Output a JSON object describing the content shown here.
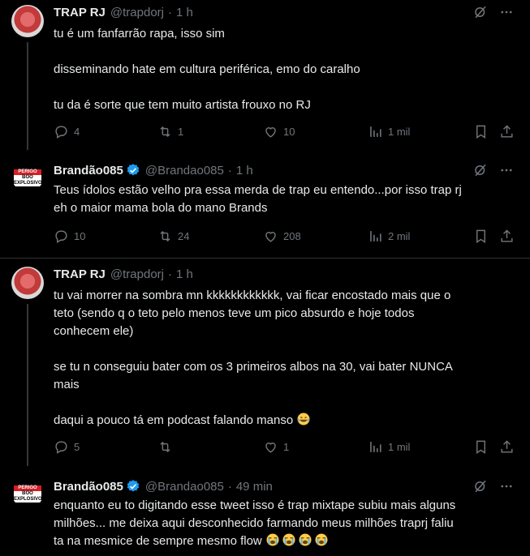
{
  "tweets": [
    {
      "name": "TRAP RJ",
      "handle": "@trapdorj",
      "time": "1 h",
      "verified": false,
      "paragraphs": [
        [
          "tu é um fanfarrão rapa, isso sim"
        ],
        [
          "disseminando hate em cultura periférica, emo do caralho"
        ],
        [
          "tu da é sorte que tem muito artista frouxo no RJ"
        ]
      ],
      "stats": {
        "replies": "4",
        "retweets": "1",
        "likes": "10",
        "views": "1 mil"
      }
    },
    {
      "name": "Brandão085",
      "handle": "@Brandao085",
      "time": "1 h",
      "verified": true,
      "paragraphs": [
        [
          "Teus ídolos estão velho pra essa merda de trap eu entendo...por isso trap rj",
          "eh o maior mama bola do mano Brands"
        ]
      ],
      "stats": {
        "replies": "10",
        "retweets": "24",
        "likes": "208",
        "views": "2 mil"
      }
    },
    {
      "name": "TRAP RJ",
      "handle": "@trapdorj",
      "time": "1 h",
      "verified": false,
      "paragraphs": [
        [
          "tu vai morrer na sombra mn kkkkkkkkkkkk, vai ficar encostado mais que o",
          "teto (sendo q o teto pelo menos teve um pico absurdo e hoje todos",
          "conhecem ele)"
        ],
        [
          "se tu n conseguiu bater com os 3 primeiros albos na 30, vai bater NUNCA",
          "mais"
        ],
        [
          "daqui a pouco tá em podcast falando manso"
        ]
      ],
      "stats": {
        "replies": "5",
        "retweets": "",
        "likes": "1",
        "views": "1 mil"
      }
    },
    {
      "name": "Brandão085",
      "handle": "@Brandao085",
      "time": "49 min",
      "verified": true,
      "paragraphs": [
        [
          "enquanto eu to digitando esse tweet isso é trap mixtape subiu mais alguns",
          "milhões...  me deixa aqui desconhecido farmando meus milhões traprj faliu",
          "ta na mesmice de sempre mesmo flow"
        ]
      ]
    }
  ],
  "avatar_badge": {
    "top": "PERIGO",
    "bottom": "BOO EXPLOSIVO"
  },
  "icons": [
    "grok-icon",
    "more-icon",
    "reply-icon",
    "retweet-icon",
    "like-icon",
    "views-icon",
    "bookmark-icon",
    "share-icon",
    "verified-icon",
    "laughing-tears-emoji",
    "crying-emoji"
  ],
  "colors": {
    "background": "#000000",
    "text": "#e7e9ea",
    "secondary": "#71767b",
    "verified": "#1d9bf0",
    "divider": "#2f3336"
  }
}
